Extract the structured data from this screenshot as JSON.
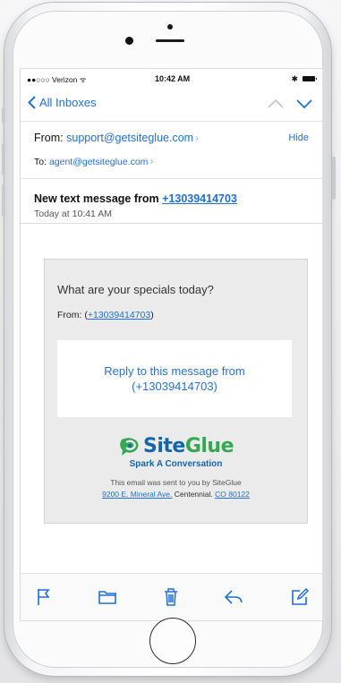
{
  "status_bar": {
    "carrier": "●●○○○ Verizon ᯤ",
    "time": "10:42 AM",
    "bluetooth": "✱"
  },
  "nav": {
    "back_label": "All Inboxes"
  },
  "header": {
    "from_label": "From:",
    "from_address": "support@getsiteglue.com",
    "hide_label": "Hide",
    "to_label": "To:",
    "to_address": "agent@getsiteglue.com"
  },
  "subject": {
    "prefix": "New  text message from",
    "phone": "+13039414703",
    "date": "Today at 10:41 AM"
  },
  "message": {
    "question": "What are your specials today?",
    "from_label": "From: (",
    "from_phone": "+13039414703",
    "from_close": ")",
    "reply_text": "Reply to this message from (+13039414703)"
  },
  "brand": {
    "name_part1": "Site",
    "name_part2": "Glue",
    "tagline": "Spark A Conversation"
  },
  "footer": {
    "line1": "This email was sent to you by SiteGlue",
    "address_link": "9200 E. Mineral Ave.",
    "city": " Centennial. ",
    "state_link": "CO 80122"
  },
  "colors": {
    "ios_blue": "#1f6fd6",
    "brand_blue": "#1565a8",
    "brand_green": "#34a853",
    "card_bg": "#ebebeb"
  },
  "toolbar_icons": [
    "flag-icon",
    "folder-icon",
    "trash-icon",
    "reply-icon",
    "compose-icon"
  ]
}
